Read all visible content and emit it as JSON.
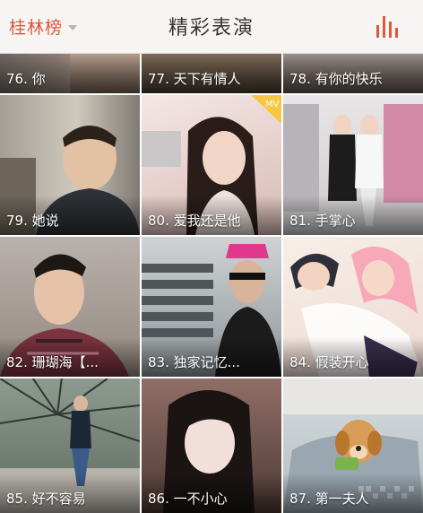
{
  "header": {
    "ranking_label": "桂林榜",
    "title": "精彩表演"
  },
  "tiles": [
    {
      "caption": "76. 你"
    },
    {
      "caption": "77. 天下有情人"
    },
    {
      "caption": "78. 有你的快乐"
    },
    {
      "caption": "79. 她说"
    },
    {
      "caption": "80. 爱我还是他",
      "badge": "MV"
    },
    {
      "caption": "81. 手掌心"
    },
    {
      "caption": "82. 珊瑚海【..."
    },
    {
      "caption": "83. 独家记忆..."
    },
    {
      "caption": "84. 假装开心"
    },
    {
      "caption": "85. 好不容易"
    },
    {
      "caption": "86. 一不小心"
    },
    {
      "caption": "87. 第一夫人"
    }
  ],
  "colors": {
    "accent": "#e0563a",
    "header_bg": "#f7f5f4",
    "title_text": "#3a3433"
  },
  "icons": {
    "ranking_dropdown": "chevron-down-icon",
    "chart": "bar-chart-icon"
  }
}
